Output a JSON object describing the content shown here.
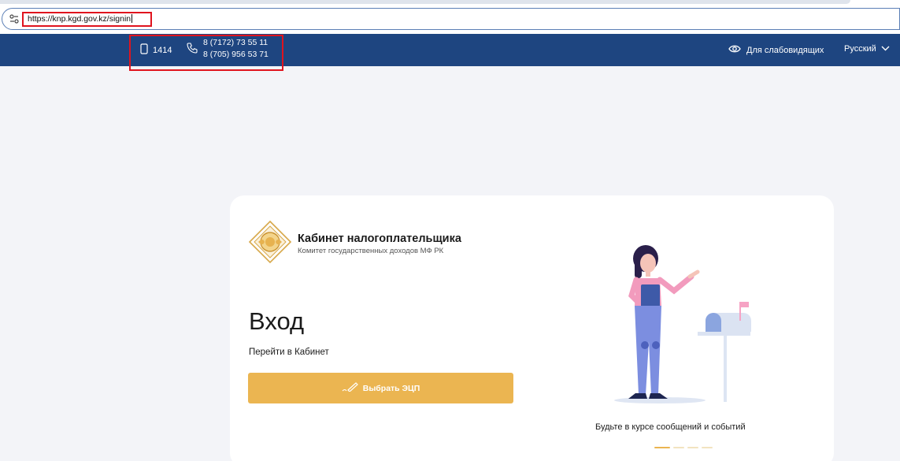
{
  "browser": {
    "url": "https://knp.kgd.gov.kz/signin"
  },
  "topbar": {
    "short_number": "1414",
    "phones": [
      "8 (7172) 73 55 11",
      "8 (705) 956 53 71"
    ],
    "accessibility_label": "Для слабовидящих",
    "language": "Русский"
  },
  "card": {
    "brand_title": "Кабинет налогоплательщика",
    "brand_subtitle": "Комитет государственных доходов МФ РК",
    "login_title": "Вход",
    "login_subtitle": "Перейти в Кабинет",
    "ecp_button_label": "Выбрать ЭЦП",
    "promo_text": "Будьте в курсе сообщений и событий",
    "carousel": {
      "total": 4,
      "active": 1
    }
  },
  "colors": {
    "topbar": "#1e4580",
    "accent": "#ebb551",
    "highlight": "#e0141e",
    "background": "#f3f4f8"
  }
}
